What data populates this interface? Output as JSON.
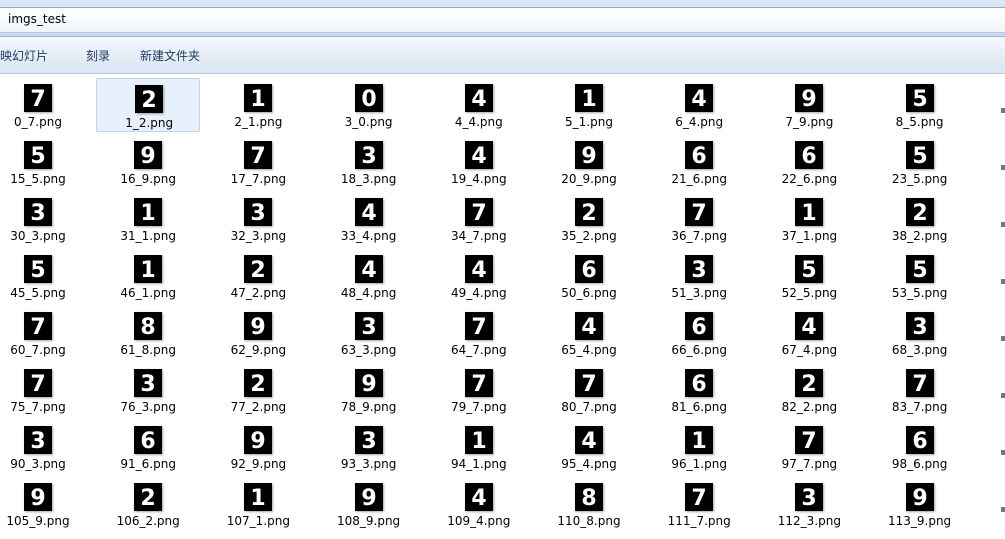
{
  "window": {
    "address": "imgs_test"
  },
  "toolbar": {
    "items": [
      "放映幻灯片",
      "刻录",
      "新建文件夹"
    ]
  },
  "colors": {
    "toolbar_text": "#1e395b",
    "selection_bg": "#e8f1fb",
    "selection_border": "#b8d6fb"
  },
  "files": {
    "rows": [
      [
        {
          "name": "0_7.png",
          "digit": "7"
        },
        {
          "name": "1_2.png",
          "digit": "2",
          "selected": true
        },
        {
          "name": "2_1.png",
          "digit": "1"
        },
        {
          "name": "3_0.png",
          "digit": "0"
        },
        {
          "name": "4_4.png",
          "digit": "4"
        },
        {
          "name": "5_1.png",
          "digit": "1"
        },
        {
          "name": "6_4.png",
          "digit": "4"
        },
        {
          "name": "7_9.png",
          "digit": "9"
        },
        {
          "name": "8_5.png",
          "digit": "5"
        }
      ],
      [
        {
          "name": "15_5.png",
          "digit": "5"
        },
        {
          "name": "16_9.png",
          "digit": "9"
        },
        {
          "name": "17_7.png",
          "digit": "7"
        },
        {
          "name": "18_3.png",
          "digit": "3"
        },
        {
          "name": "19_4.png",
          "digit": "4"
        },
        {
          "name": "20_9.png",
          "digit": "9"
        },
        {
          "name": "21_6.png",
          "digit": "6"
        },
        {
          "name": "22_6.png",
          "digit": "6"
        },
        {
          "name": "23_5.png",
          "digit": "5"
        }
      ],
      [
        {
          "name": "30_3.png",
          "digit": "3"
        },
        {
          "name": "31_1.png",
          "digit": "1"
        },
        {
          "name": "32_3.png",
          "digit": "3"
        },
        {
          "name": "33_4.png",
          "digit": "4"
        },
        {
          "name": "34_7.png",
          "digit": "7"
        },
        {
          "name": "35_2.png",
          "digit": "2"
        },
        {
          "name": "36_7.png",
          "digit": "7"
        },
        {
          "name": "37_1.png",
          "digit": "1"
        },
        {
          "name": "38_2.png",
          "digit": "2"
        }
      ],
      [
        {
          "name": "45_5.png",
          "digit": "5"
        },
        {
          "name": "46_1.png",
          "digit": "1"
        },
        {
          "name": "47_2.png",
          "digit": "2"
        },
        {
          "name": "48_4.png",
          "digit": "4"
        },
        {
          "name": "49_4.png",
          "digit": "4"
        },
        {
          "name": "50_6.png",
          "digit": "6"
        },
        {
          "name": "51_3.png",
          "digit": "3"
        },
        {
          "name": "52_5.png",
          "digit": "5"
        },
        {
          "name": "53_5.png",
          "digit": "5"
        }
      ],
      [
        {
          "name": "60_7.png",
          "digit": "7"
        },
        {
          "name": "61_8.png",
          "digit": "8"
        },
        {
          "name": "62_9.png",
          "digit": "9"
        },
        {
          "name": "63_3.png",
          "digit": "3"
        },
        {
          "name": "64_7.png",
          "digit": "7"
        },
        {
          "name": "65_4.png",
          "digit": "4"
        },
        {
          "name": "66_6.png",
          "digit": "6"
        },
        {
          "name": "67_4.png",
          "digit": "4"
        },
        {
          "name": "68_3.png",
          "digit": "3"
        }
      ],
      [
        {
          "name": "75_7.png",
          "digit": "7"
        },
        {
          "name": "76_3.png",
          "digit": "3"
        },
        {
          "name": "77_2.png",
          "digit": "2"
        },
        {
          "name": "78_9.png",
          "digit": "9"
        },
        {
          "name": "79_7.png",
          "digit": "7"
        },
        {
          "name": "80_7.png",
          "digit": "7"
        },
        {
          "name": "81_6.png",
          "digit": "6"
        },
        {
          "name": "82_2.png",
          "digit": "2"
        },
        {
          "name": "83_7.png",
          "digit": "7"
        }
      ],
      [
        {
          "name": "90_3.png",
          "digit": "3"
        },
        {
          "name": "91_6.png",
          "digit": "6"
        },
        {
          "name": "92_9.png",
          "digit": "9"
        },
        {
          "name": "93_3.png",
          "digit": "3"
        },
        {
          "name": "94_1.png",
          "digit": "1"
        },
        {
          "name": "95_4.png",
          "digit": "4"
        },
        {
          "name": "96_1.png",
          "digit": "1"
        },
        {
          "name": "97_7.png",
          "digit": "7"
        },
        {
          "name": "98_6.png",
          "digit": "6"
        }
      ],
      [
        {
          "name": "105_9.png",
          "digit": "9"
        },
        {
          "name": "106_2.png",
          "digit": "2"
        },
        {
          "name": "107_1.png",
          "digit": "1"
        },
        {
          "name": "108_9.png",
          "digit": "9"
        },
        {
          "name": "109_4.png",
          "digit": "4"
        },
        {
          "name": "110_8.png",
          "digit": "8"
        },
        {
          "name": "111_7.png",
          "digit": "7"
        },
        {
          "name": "112_3.png",
          "digit": "3"
        },
        {
          "name": "113_9.png",
          "digit": "9"
        }
      ]
    ]
  }
}
